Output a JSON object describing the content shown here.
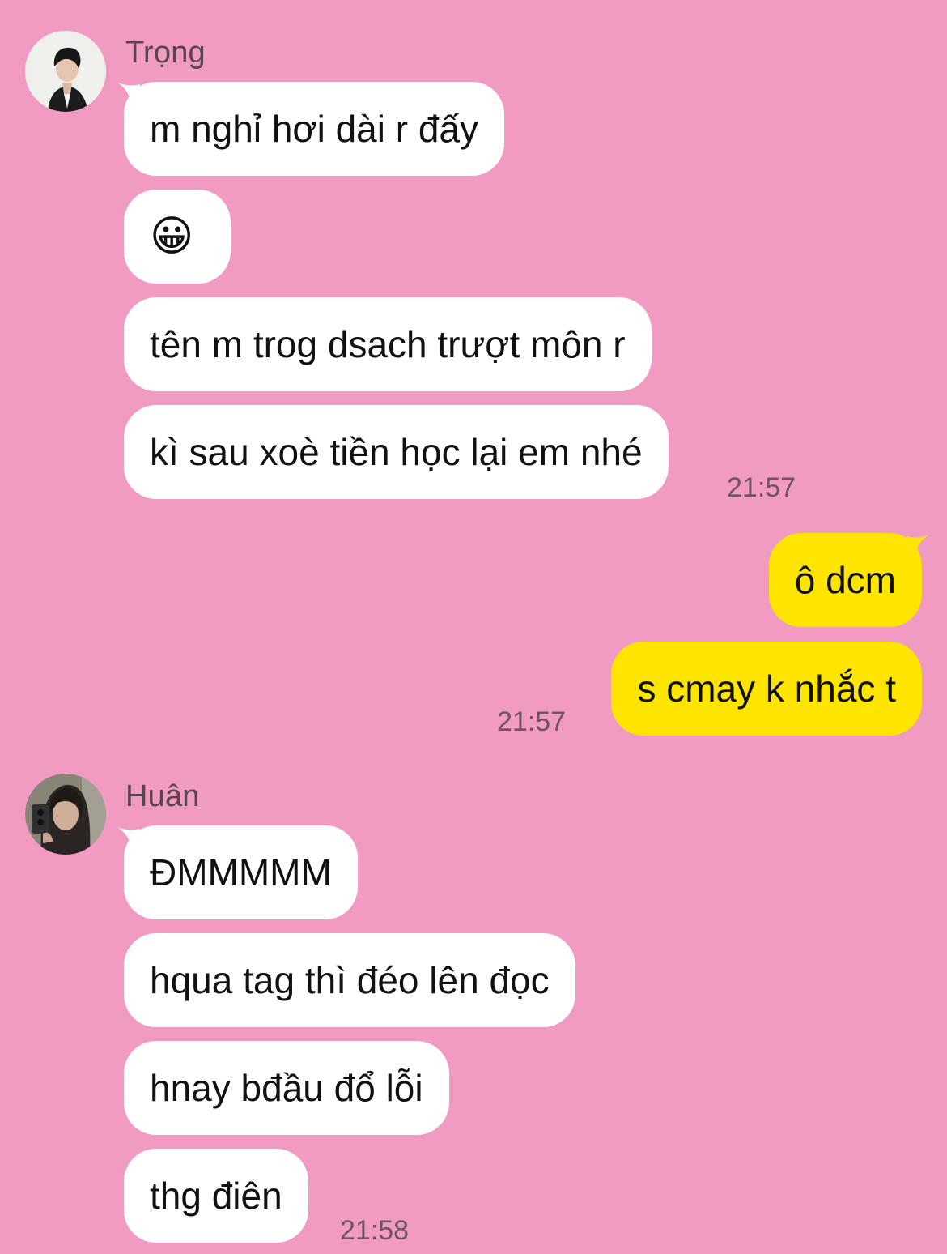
{
  "colors": {
    "background": "#F29BC2",
    "incoming_bubble": "#FFFFFF",
    "outgoing_bubble": "#FEE500",
    "meta_text": "#6E5360"
  },
  "groups": [
    {
      "sender": "Trọng",
      "avatar_icon": "user-avatar-photo",
      "messages": [
        "m nghỉ hơi dài r đấy",
        "😀",
        "tên m trog dsach trượt môn r",
        "kì sau xoè tiền học lại em nhé"
      ],
      "time": "21:57"
    },
    {
      "sender": "me",
      "messages": [
        "ô dcm",
        "s cmay k nhắc t"
      ],
      "time": "21:57"
    },
    {
      "sender": "Huân",
      "avatar_icon": "user-avatar-photo",
      "messages": [
        "ĐMMMMM",
        "hqua tag thì đéo lên đọc",
        "hnay bđầu đổ lỗi",
        "thg điên"
      ],
      "time": "21:58"
    }
  ]
}
